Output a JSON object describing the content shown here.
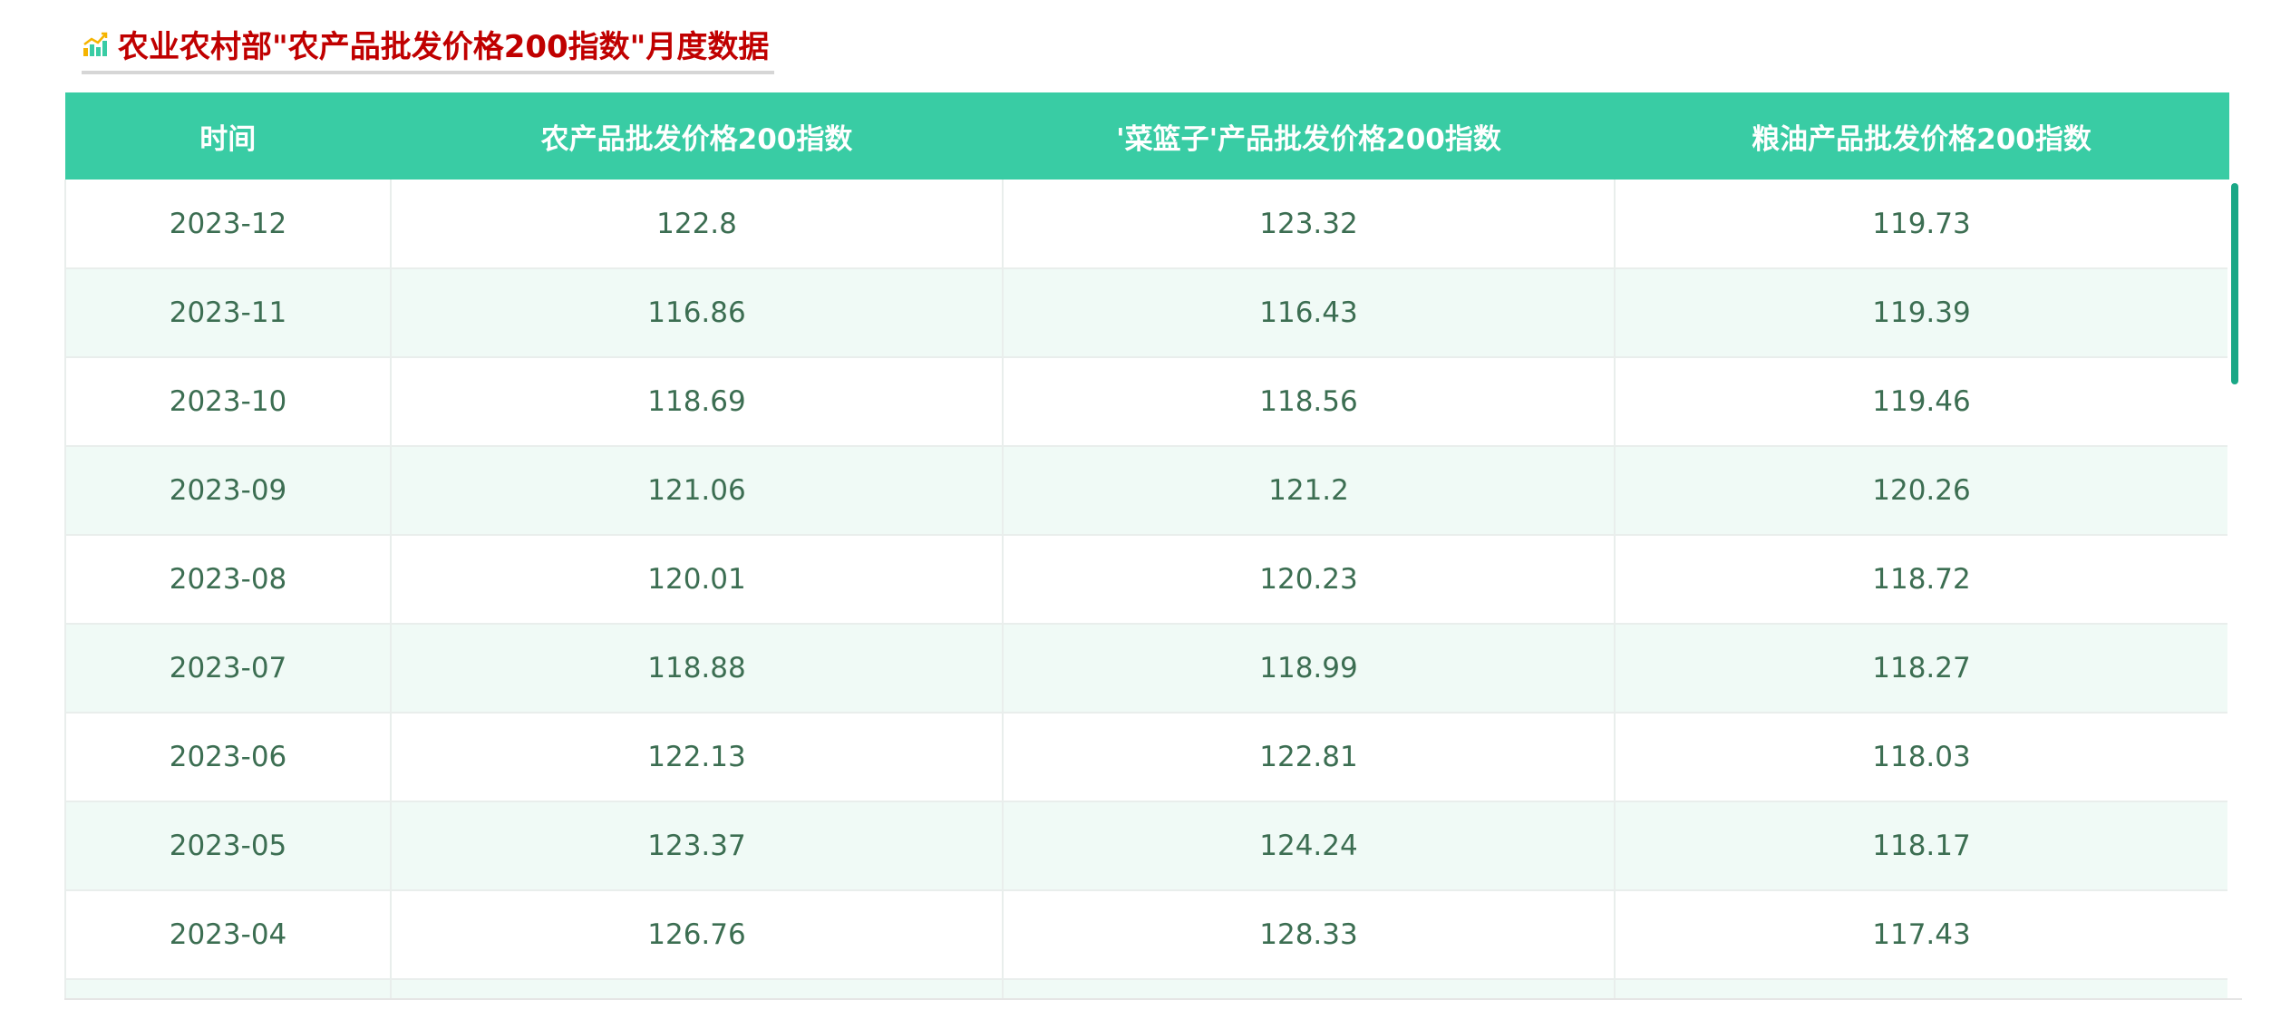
{
  "page": {
    "title": "农业农村部\"农产品批发价格200指数\"月度数据",
    "title_icon": "bar-chart-trend-icon",
    "colors": {
      "title": "#c00000",
      "header_bg": "#39cca4",
      "header_text": "#ffffff",
      "cell_text": "#3c6e52",
      "row_alt": "#f0faf6",
      "scrollbar": "#1aa886"
    }
  },
  "table": {
    "columns": [
      "时间",
      "农产品批发价格200指数",
      "'菜篮子'产品批发价格200指数",
      "粮油产品批发价格200指数"
    ],
    "rows": [
      [
        "2023-12",
        "122.8",
        "123.32",
        "119.73"
      ],
      [
        "2023-11",
        "116.86",
        "116.43",
        "119.39"
      ],
      [
        "2023-10",
        "118.69",
        "118.56",
        "119.46"
      ],
      [
        "2023-09",
        "121.06",
        "121.2",
        "120.26"
      ],
      [
        "2023-08",
        "120.01",
        "120.23",
        "118.72"
      ],
      [
        "2023-07",
        "118.88",
        "118.99",
        "118.27"
      ],
      [
        "2023-06",
        "122.13",
        "122.81",
        "118.03"
      ],
      [
        "2023-05",
        "123.37",
        "124.24",
        "118.17"
      ],
      [
        "2023-04",
        "126.76",
        "128.33",
        "117.43"
      ],
      [
        "",
        "",
        "",
        ""
      ]
    ]
  }
}
